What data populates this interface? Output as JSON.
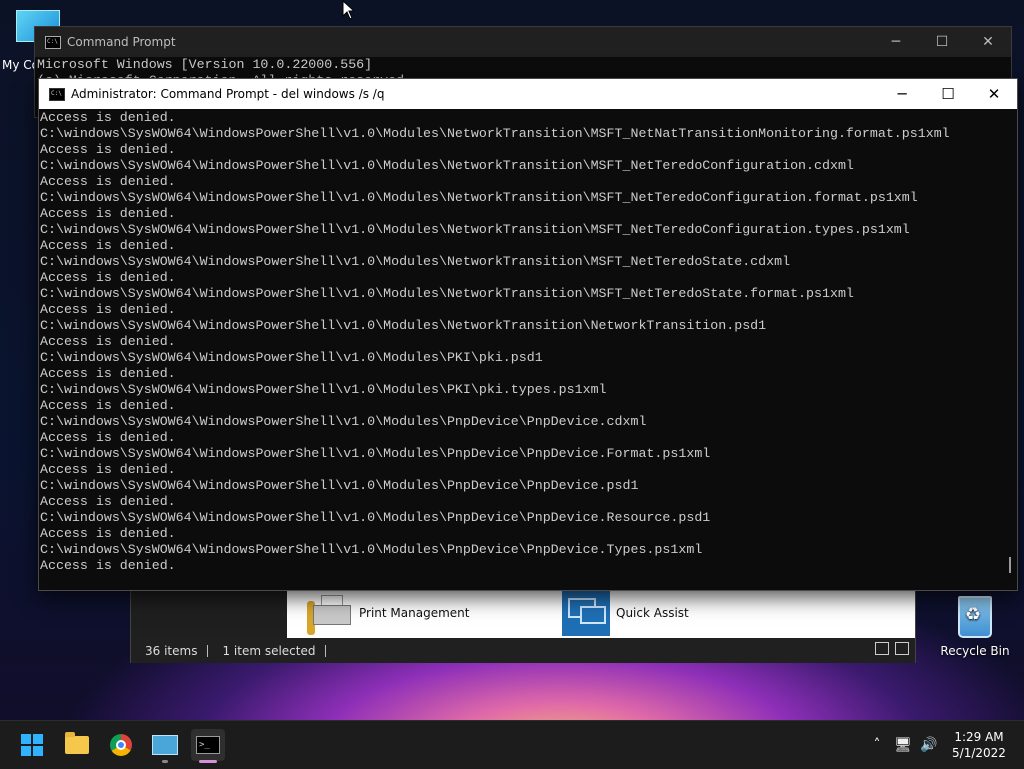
{
  "desktop": {
    "my_computer_label": "My Co",
    "recycle_bin_label": "Recycle Bin"
  },
  "explorer": {
    "items": [
      {
        "label": "Print Management"
      },
      {
        "label": "Quick Assist"
      }
    ],
    "status_items": "36 items",
    "status_selected": "1 item selected"
  },
  "cmd_back": {
    "title": "Command Prompt",
    "line1": "Microsoft Windows [Version 10.0.22000.556]",
    "line2": "(c) Microsoft Corporation. All rights reserved."
  },
  "cmd_front": {
    "title": "Administrator: Command Prompt - del  windows /s /q",
    "lines": [
      "Access is denied.",
      "C:\\windows\\SysWOW64\\WindowsPowerShell\\v1.0\\Modules\\NetworkTransition\\MSFT_NetNatTransitionMonitoring.format.ps1xml",
      "Access is denied.",
      "C:\\windows\\SysWOW64\\WindowsPowerShell\\v1.0\\Modules\\NetworkTransition\\MSFT_NetTeredoConfiguration.cdxml",
      "Access is denied.",
      "C:\\windows\\SysWOW64\\WindowsPowerShell\\v1.0\\Modules\\NetworkTransition\\MSFT_NetTeredoConfiguration.format.ps1xml",
      "Access is denied.",
      "C:\\windows\\SysWOW64\\WindowsPowerShell\\v1.0\\Modules\\NetworkTransition\\MSFT_NetTeredoConfiguration.types.ps1xml",
      "Access is denied.",
      "C:\\windows\\SysWOW64\\WindowsPowerShell\\v1.0\\Modules\\NetworkTransition\\MSFT_NetTeredoState.cdxml",
      "Access is denied.",
      "C:\\windows\\SysWOW64\\WindowsPowerShell\\v1.0\\Modules\\NetworkTransition\\MSFT_NetTeredoState.format.ps1xml",
      "Access is denied.",
      "C:\\windows\\SysWOW64\\WindowsPowerShell\\v1.0\\Modules\\NetworkTransition\\NetworkTransition.psd1",
      "Access is denied.",
      "C:\\windows\\SysWOW64\\WindowsPowerShell\\v1.0\\Modules\\PKI\\pki.psd1",
      "Access is denied.",
      "C:\\windows\\SysWOW64\\WindowsPowerShell\\v1.0\\Modules\\PKI\\pki.types.ps1xml",
      "Access is denied.",
      "C:\\windows\\SysWOW64\\WindowsPowerShell\\v1.0\\Modules\\PnpDevice\\PnpDevice.cdxml",
      "Access is denied.",
      "C:\\windows\\SysWOW64\\WindowsPowerShell\\v1.0\\Modules\\PnpDevice\\PnpDevice.Format.ps1xml",
      "Access is denied.",
      "C:\\windows\\SysWOW64\\WindowsPowerShell\\v1.0\\Modules\\PnpDevice\\PnpDevice.psd1",
      "Access is denied.",
      "C:\\windows\\SysWOW64\\WindowsPowerShell\\v1.0\\Modules\\PnpDevice\\PnpDevice.Resource.psd1",
      "Access is denied.",
      "C:\\windows\\SysWOW64\\WindowsPowerShell\\v1.0\\Modules\\PnpDevice\\PnpDevice.Types.ps1xml",
      "Access is denied."
    ]
  },
  "taskbar": {
    "apps": [
      "start-icon",
      "file-explorer-icon",
      "chrome-icon",
      "control-panel-icon",
      "command-prompt-icon"
    ],
    "time": "1:29 AM",
    "date": "5/1/2022",
    "accent": "#d88ed8"
  }
}
